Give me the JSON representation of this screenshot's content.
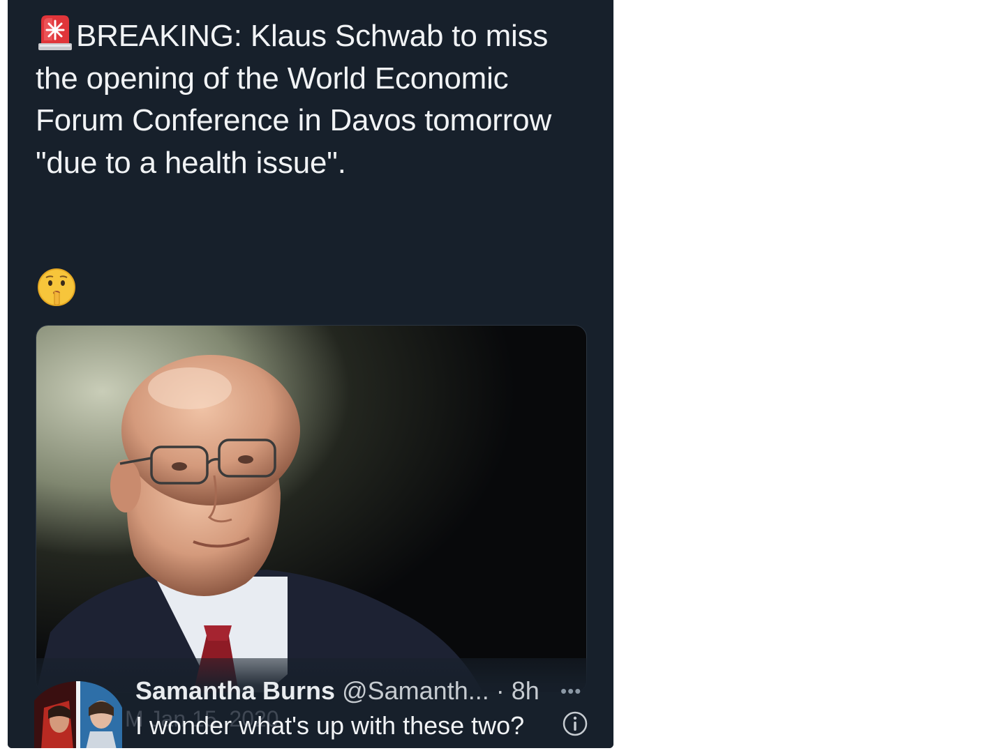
{
  "tweet": {
    "text": "BREAKING: Klaus Schwab to miss the opening of the World Economic Forum Conference in Davos tomorrow \"due to a health issue\".",
    "lead_icon": "police-siren-emoji",
    "reaction_icon": "shushing-face-emoji"
  },
  "media": {
    "subject_icon": "portrait-photo-bald-man-glasses-suit"
  },
  "quoted": {
    "author_name": "Samantha Burns",
    "handle": "@Samanth...",
    "time": "· 8h",
    "more_icon": "•••",
    "body": "I wonder what's up with these two?",
    "date_ghost": "M  Jan 15, 2020",
    "avatar_icon": "movie-poster-avatar",
    "info_icon": "info-icon"
  },
  "colors": {
    "panel_bg": "#17202b",
    "text": "#f1f3f5",
    "muted": "#8b98a5"
  }
}
